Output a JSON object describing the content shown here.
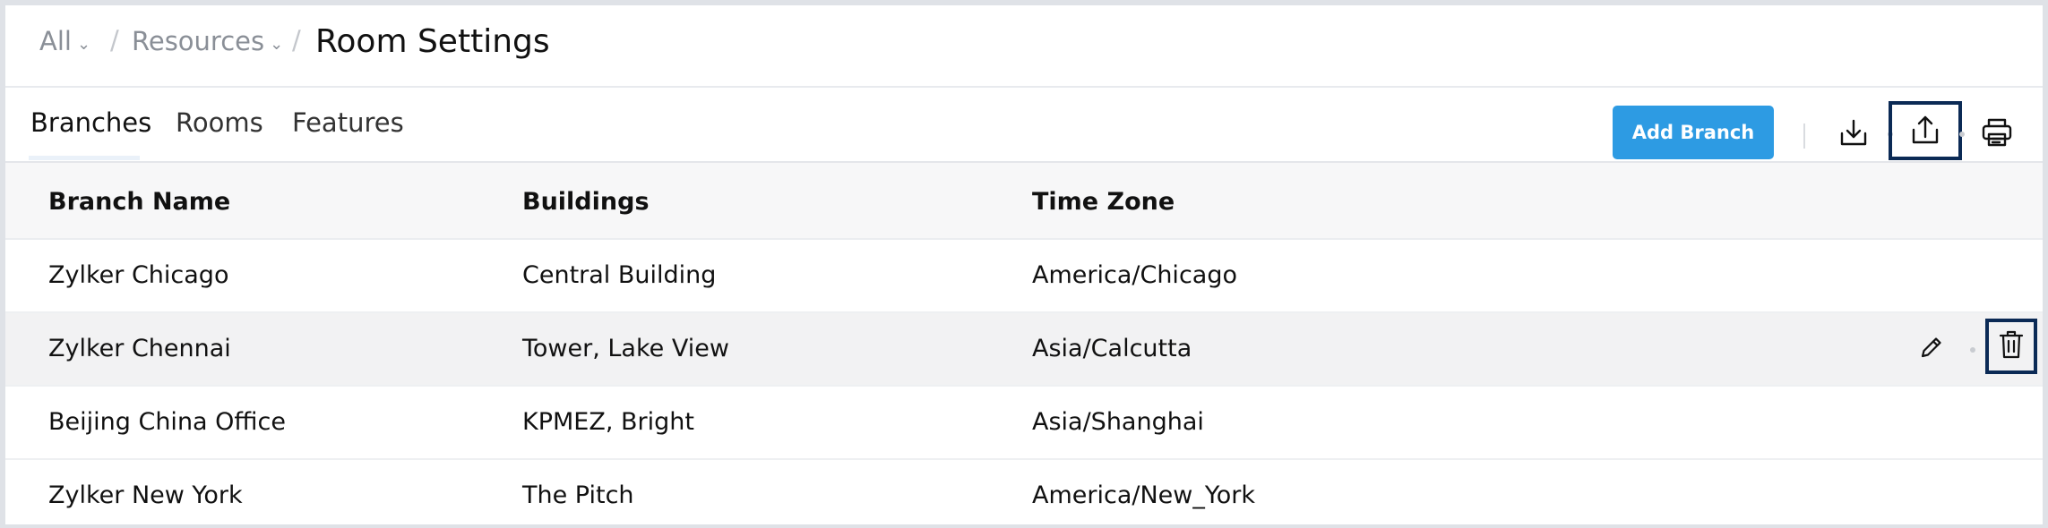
{
  "breadcrumb": {
    "all_label": "All",
    "resources_label": "Resources",
    "separator": "/",
    "title": "Room Settings"
  },
  "tabs": [
    {
      "label": "Branches",
      "active": true
    },
    {
      "label": "Rooms",
      "active": false
    },
    {
      "label": "Features",
      "active": false
    }
  ],
  "toolbar": {
    "add_label": "Add Branch",
    "icons": [
      "import-icon",
      "export-icon",
      "print-icon"
    ]
  },
  "table": {
    "columns": [
      "Branch Name",
      "Buildings",
      "Time Zone"
    ],
    "rows": [
      {
        "name": "Zylker Chicago",
        "buildings": "Central Building",
        "timezone": "America/Chicago"
      },
      {
        "name": "Zylker Chennai",
        "buildings": "Tower, Lake View",
        "timezone": "Asia/Calcutta"
      },
      {
        "name": "Beijing China Office",
        "buildings": "KPMEZ, Bright",
        "timezone": "Asia/Shanghai"
      },
      {
        "name": "Zylker New York",
        "buildings": "The Pitch",
        "timezone": "America/New_York"
      }
    ]
  },
  "colors": {
    "accent": "#2d9be3",
    "focus_outline": "#0b2a55"
  }
}
